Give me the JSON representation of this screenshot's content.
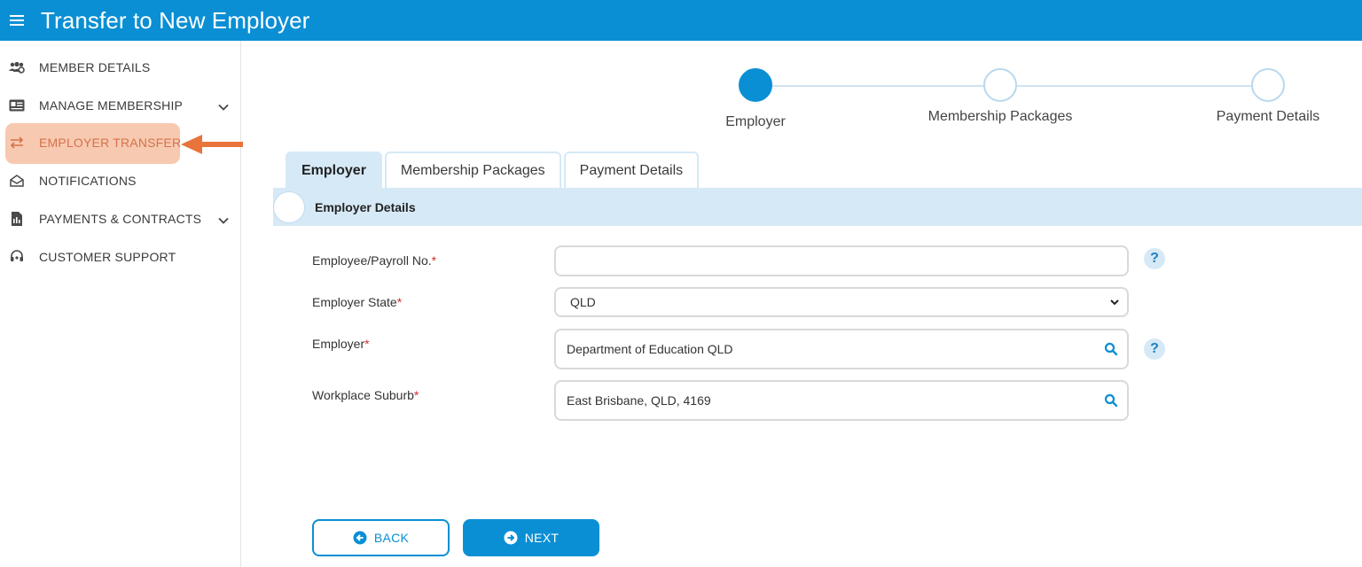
{
  "header": {
    "title": "Transfer to New Employer",
    "menu_icon": "hamburger-icon",
    "background": "#0a8fd4"
  },
  "sidebar": {
    "items": [
      {
        "label": "MEMBER DETAILS",
        "icon": "member-group-icon"
      },
      {
        "label": "MANAGE MEMBERSHIP",
        "icon": "id-card-icon",
        "expandable": true
      },
      {
        "label": "EMPLOYER TRANSFER",
        "icon": "transfer-arrows-icon",
        "active": true
      },
      {
        "label": "NOTIFICATIONS",
        "icon": "envelope-icon"
      },
      {
        "label": "PAYMENTS & CONTRACTS",
        "icon": "document-icon",
        "expandable": true
      },
      {
        "label": "CUSTOMER SUPPORT",
        "icon": "headset-icon"
      }
    ],
    "highlight_color": "#f8c9b1",
    "pointer_arrow_color": "#e8743b"
  },
  "stepper": {
    "steps": [
      {
        "label": "Employer",
        "active": true
      },
      {
        "label": "Membership Packages",
        "active": false
      },
      {
        "label": "Payment Details",
        "active": false
      }
    ]
  },
  "tabs": [
    {
      "label": "Employer",
      "active": true
    },
    {
      "label": "Membership Packages",
      "active": false
    },
    {
      "label": "Payment Details",
      "active": false
    }
  ],
  "section": {
    "title": "Employer Details"
  },
  "form": {
    "payroll": {
      "label": "Employee/Payroll No.",
      "required_mark": "*",
      "value": ""
    },
    "state": {
      "label": "Employer State",
      "required_mark": "*",
      "value": "QLD"
    },
    "employer": {
      "label": "Employer",
      "required_mark": "*",
      "value": "Department of Education QLD"
    },
    "suburb": {
      "label": "Workplace Suburb",
      "required_mark": "*",
      "value": "East Brisbane, QLD, 4169"
    },
    "help_glyph": "?"
  },
  "buttons": {
    "back_label": "BACK",
    "next_label": "NEXT"
  }
}
